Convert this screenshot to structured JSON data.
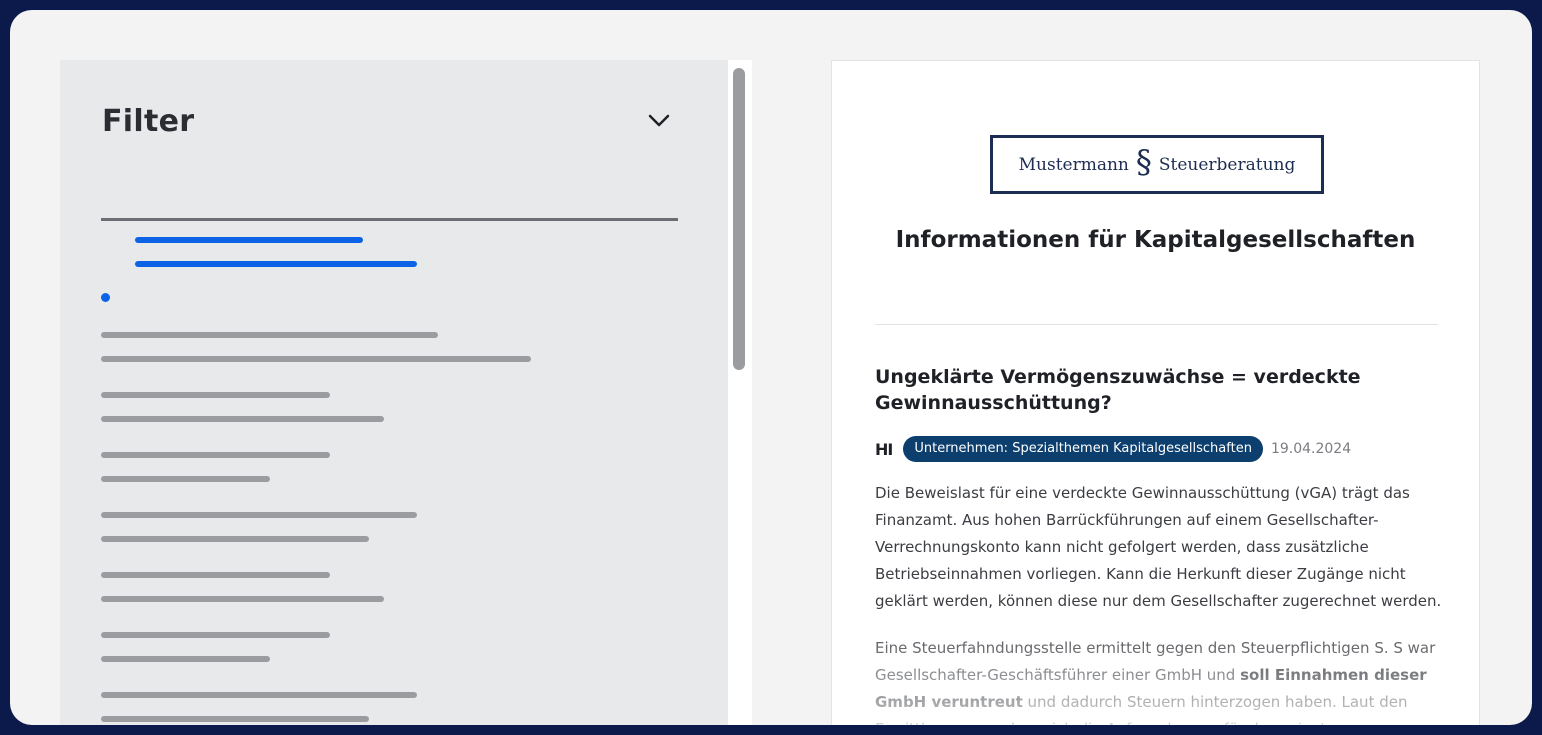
{
  "filter": {
    "title": "Filter",
    "toggle_icon": "chevron-down-icon"
  },
  "colors": {
    "active": "#0d63e8",
    "placeholder": "#9b9ca0",
    "badge": "#0c3e6e"
  },
  "article": {
    "logo_left": "Mustermann",
    "logo_symbol": "§",
    "logo_right": "Steuerberatung",
    "page_title": "Informationen für Kapitalgesellschaften",
    "headline": "Ungeklärte Vermögenszuwächse = verdeckte Gewinnausschüttung?",
    "source": "HI",
    "category": "Unternehmen: Spezialthemen Kapitalgesellschaften",
    "date": "19.04.2024",
    "lead": "Die Beweislast für eine verdeckte Gewinnausschüttung (vGA) trägt das Finanzamt. Aus hohen Barrückführungen auf einem Gesellschafter-Verrechnungskonto kann nicht gefolgert werden, dass zusätzliche Betriebseinnahmen vorliegen. Kann die Herkunft dieser Zugänge nicht geklärt werden, können diese nur dem Gesellschafter zugerechnet werden.",
    "body_part1": "Eine Steuerfahndungsstelle ermittelt gegen den Steuerpflichtigen S. S war Gesellschafter-Geschäftsführer einer GmbH und ",
    "body_bold": "soll Einnahmen dieser GmbH veruntreut",
    "body_part2": " und dadurch Steuern hinterzogen haben. Laut den Ermittlungen ergeben sich die Aufwendungen für den privaten"
  }
}
